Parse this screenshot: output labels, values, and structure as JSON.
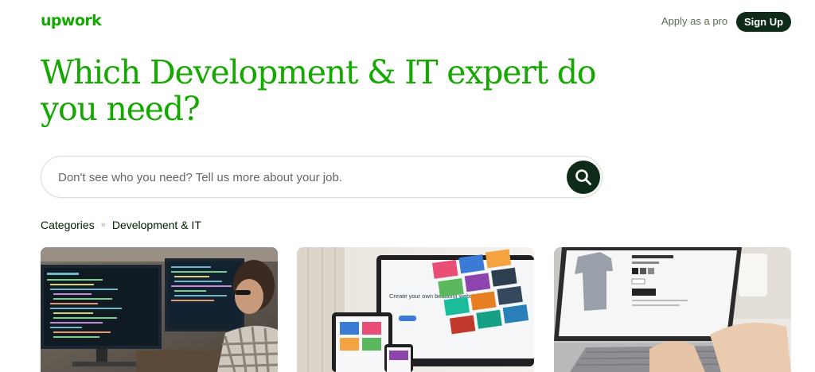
{
  "header": {
    "logo": "upwork",
    "apply_link": "Apply as a pro",
    "signup_label": "Sign Up"
  },
  "hero": {
    "headline": "Which Development & IT expert do you need?"
  },
  "search": {
    "placeholder": "Don't see who you need? Tell us more about your job.",
    "value": ""
  },
  "breadcrumb": {
    "items": [
      "Categories",
      "Development & IT"
    ],
    "separator": "»"
  },
  "cards": {
    "website_mockup_text": "Create your own beautiful website"
  },
  "colors": {
    "brand_green": "#14a800",
    "dark_green": "#0d2b16",
    "text": "#001e00",
    "muted": "#5e6d55"
  },
  "icons": {
    "search_button": "search-icon"
  }
}
